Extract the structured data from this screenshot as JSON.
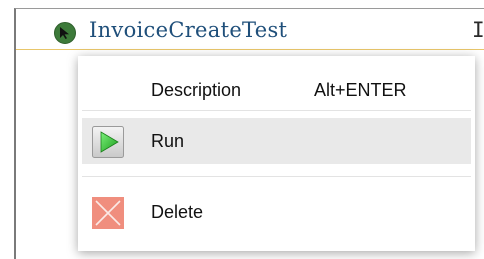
{
  "editor": {
    "class_name": "InvoiceCreateTest",
    "trailing_code": "If"
  },
  "popup": {
    "header": {
      "description_label": "Description",
      "shortcut_label": "Alt+ENTER"
    },
    "items": [
      {
        "label": "Run",
        "icon": "run-play-icon",
        "highlighted": true
      },
      {
        "label": "Delete",
        "icon": "delete-x-icon",
        "highlighted": false
      }
    ]
  },
  "colors": {
    "class_name": "#1f4f7a",
    "run_icon": "#2fbf2f",
    "delete_icon": "#f08e7e",
    "highlight": "#e9e9e9"
  }
}
